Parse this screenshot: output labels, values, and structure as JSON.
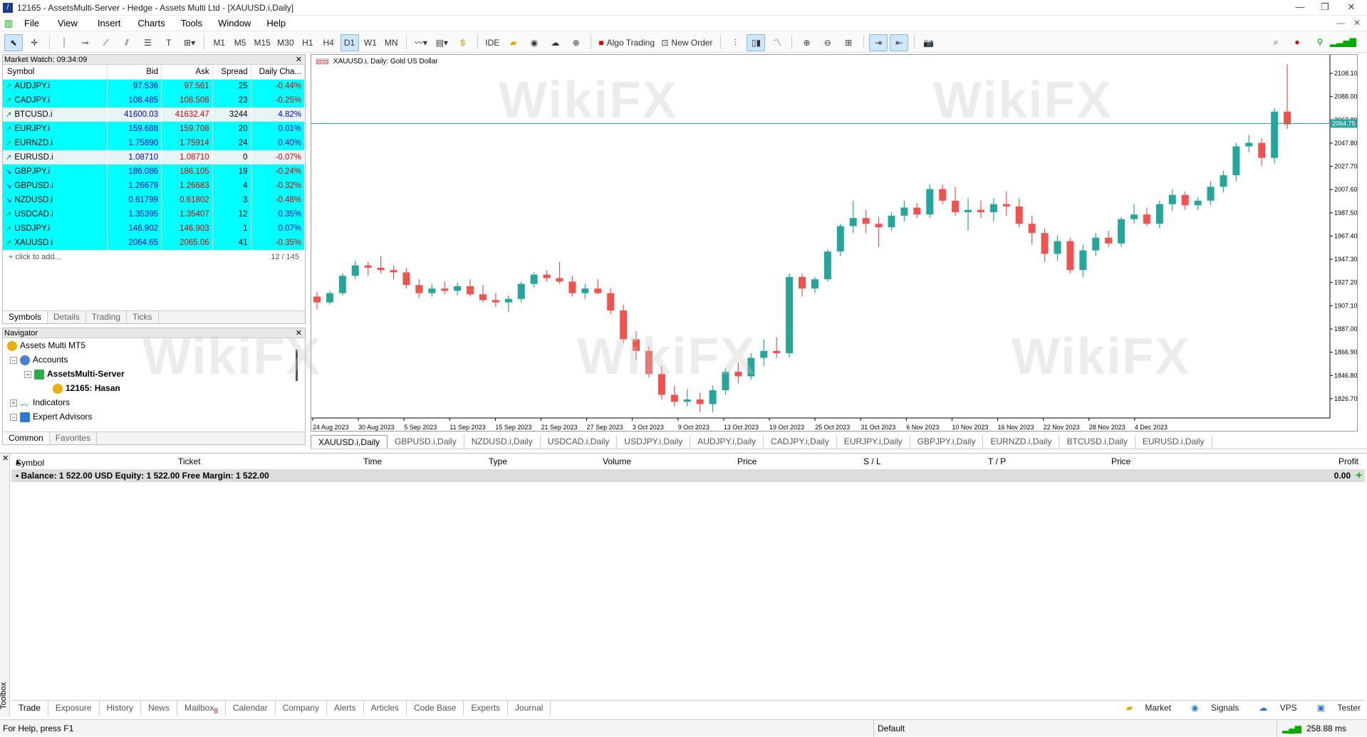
{
  "window": {
    "title": "12165 - AssetsMulti-Server - Hedge - Assets Multi Ltd - [XAUUSD.i,Daily]"
  },
  "menu": [
    "File",
    "View",
    "Insert",
    "Charts",
    "Tools",
    "Window",
    "Help"
  ],
  "timeframes": [
    "M1",
    "M5",
    "M15",
    "M30",
    "H1",
    "H4",
    "D1",
    "W1",
    "MN"
  ],
  "toolbar": {
    "ide": "IDE",
    "algo": "Algo Trading",
    "neworder": "New Order",
    "active_tf": "D1"
  },
  "market_watch": {
    "title": "Market Watch: 09:34:09",
    "columns": [
      "Symbol",
      "Bid",
      "Ask",
      "Spread",
      "Daily Cha..."
    ],
    "rows": [
      {
        "symbol": "AUDJPY.i",
        "bid": "97.536",
        "ask": "97.561",
        "spread": "25",
        "change": "-0.44%",
        "dir": "up"
      },
      {
        "symbol": "CADJPY.i",
        "bid": "108.485",
        "ask": "108.508",
        "spread": "23",
        "change": "-0.25%",
        "dir": "up"
      },
      {
        "symbol": "BTCUSD.i",
        "bid": "41600.03",
        "ask": "41632.47",
        "spread": "3244",
        "change": "4.82%",
        "dir": "alt"
      },
      {
        "symbol": "EURJPY.i",
        "bid": "159.688",
        "ask": "159.708",
        "spread": "20",
        "change": "0.01%",
        "dir": "up"
      },
      {
        "symbol": "EURNZD.i",
        "bid": "1.75890",
        "ask": "1.75914",
        "spread": "24",
        "change": "0.40%",
        "dir": "up"
      },
      {
        "symbol": "EURUSD.i",
        "bid": "1.08710",
        "ask": "1.08710",
        "spread": "0",
        "change": "-0.07%",
        "dir": "alt"
      },
      {
        "symbol": "GBPJPY.i",
        "bid": "186.086",
        "ask": "186.105",
        "spread": "19",
        "change": "-0.24%",
        "dir": "dn"
      },
      {
        "symbol": "GBPUSD.i",
        "bid": "1.26679",
        "ask": "1.26683",
        "spread": "4",
        "change": "-0.32%",
        "dir": "dn"
      },
      {
        "symbol": "NZDUSD.i",
        "bid": "0.61799",
        "ask": "0.61802",
        "spread": "3",
        "change": "-0.48%",
        "dir": "dn"
      },
      {
        "symbol": "USDCAD.i",
        "bid": "1.35395",
        "ask": "1.35407",
        "spread": "12",
        "change": "0.35%",
        "dir": "up"
      },
      {
        "symbol": "USDJPY.i",
        "bid": "146.902",
        "ask": "146.903",
        "spread": "1",
        "change": "0.07%",
        "dir": "up"
      },
      {
        "symbol": "XAUUSD.i",
        "bid": "2064.65",
        "ask": "2065.06",
        "spread": "41",
        "change": "-0.35%",
        "dir": "up"
      }
    ],
    "add_label": "click to add...",
    "count": "12 / 145",
    "tabs": [
      "Symbols",
      "Details",
      "Trading",
      "Ticks"
    ]
  },
  "navigator": {
    "title": "Navigator",
    "root": "Assets Multi MT5",
    "accounts": "Accounts",
    "server": "AssetsMulti-Server",
    "account": "12165: Hasan",
    "indicators": "Indicators",
    "experts": "Expert Advisors",
    "tabs": [
      "Common",
      "Favorites"
    ]
  },
  "chart": {
    "label": "XAUUSD.i, Daily:  Gold US Dollar",
    "current_price": "2064.75"
  },
  "chart_data": {
    "type": "candlestick",
    "ylim": [
      1810,
      2118
    ],
    "yticks": [
      "2108.10",
      "2088.00",
      "2067.80",
      "2047.80",
      "2027.70",
      "2007.60",
      "1987.50",
      "1967.40",
      "1947.30",
      "1927.20",
      "1907.10",
      "1887.00",
      "1866.90",
      "1846.80",
      "1826.70"
    ],
    "xticks": [
      "24 Aug 2023",
      "30 Aug 2023",
      "5 Sep 2023",
      "11 Sep 2023",
      "15 Sep 2023",
      "21 Sep 2023",
      "27 Sep 2023",
      "3 Oct 2023",
      "9 Oct 2023",
      "13 Oct 2023",
      "19 Oct 2023",
      "25 Oct 2023",
      "31 Oct 2023",
      "6 Nov 2023",
      "10 Nov 2023",
      "16 Nov 2023",
      "22 Nov 2023",
      "28 Nov 2023",
      "4 Dec 2023"
    ],
    "hline": 2064.75,
    "candles": [
      [
        1915,
        1919,
        1904,
        1910
      ],
      [
        1910,
        1920,
        1908,
        1918
      ],
      [
        1918,
        1935,
        1916,
        1933
      ],
      [
        1933,
        1946,
        1930,
        1942
      ],
      [
        1942,
        1945,
        1933,
        1940
      ],
      [
        1940,
        1950,
        1935,
        1938
      ],
      [
        1938,
        1942,
        1930,
        1936
      ],
      [
        1936,
        1940,
        1922,
        1925
      ],
      [
        1925,
        1930,
        1914,
        1918
      ],
      [
        1918,
        1926,
        1915,
        1922
      ],
      [
        1922,
        1928,
        1917,
        1920
      ],
      [
        1920,
        1927,
        1916,
        1924
      ],
      [
        1924,
        1930,
        1915,
        1917
      ],
      [
        1917,
        1925,
        1910,
        1912
      ],
      [
        1912,
        1918,
        1906,
        1910
      ],
      [
        1910,
        1916,
        1902,
        1913
      ],
      [
        1913,
        1928,
        1910,
        1926
      ],
      [
        1926,
        1936,
        1923,
        1934
      ],
      [
        1934,
        1938,
        1928,
        1931
      ],
      [
        1931,
        1945,
        1926,
        1928
      ],
      [
        1928,
        1933,
        1915,
        1918
      ],
      [
        1918,
        1926,
        1913,
        1922
      ],
      [
        1922,
        1930,
        1917,
        1918
      ],
      [
        1918,
        1922,
        1900,
        1903
      ],
      [
        1903,
        1908,
        1875,
        1878
      ],
      [
        1878,
        1885,
        1860,
        1868
      ],
      [
        1868,
        1872,
        1845,
        1848
      ],
      [
        1848,
        1855,
        1826,
        1830
      ],
      [
        1830,
        1838,
        1820,
        1824
      ],
      [
        1824,
        1835,
        1820,
        1826
      ],
      [
        1826,
        1832,
        1815,
        1822
      ],
      [
        1822,
        1838,
        1815,
        1834
      ],
      [
        1834,
        1853,
        1830,
        1850
      ],
      [
        1850,
        1858,
        1840,
        1846
      ],
      [
        1846,
        1866,
        1843,
        1862
      ],
      [
        1862,
        1878,
        1855,
        1868
      ],
      [
        1868,
        1880,
        1862,
        1866
      ],
      [
        1866,
        1935,
        1862,
        1932
      ],
      [
        1932,
        1935,
        1915,
        1922
      ],
      [
        1922,
        1932,
        1918,
        1930
      ],
      [
        1930,
        1956,
        1928,
        1954
      ],
      [
        1954,
        1978,
        1950,
        1976
      ],
      [
        1976,
        1998,
        1970,
        1983
      ],
      [
        1983,
        1990,
        1970,
        1978
      ],
      [
        1978,
        1984,
        1958,
        1975
      ],
      [
        1975,
        1988,
        1972,
        1985
      ],
      [
        1985,
        1998,
        1980,
        1992
      ],
      [
        1992,
        1996,
        1983,
        1986
      ],
      [
        1986,
        2012,
        1983,
        2008
      ],
      [
        2008,
        2012,
        1995,
        1998
      ],
      [
        1998,
        2010,
        1985,
        1988
      ],
      [
        1988,
        2000,
        1972,
        1990
      ],
      [
        1990,
        1998,
        1983,
        1988
      ],
      [
        1988,
        2000,
        1980,
        1995
      ],
      [
        1995,
        2006,
        1985,
        1993
      ],
      [
        1993,
        2000,
        1975,
        1978
      ],
      [
        1978,
        1985,
        1960,
        1970
      ],
      [
        1970,
        1974,
        1945,
        1952
      ],
      [
        1952,
        1968,
        1946,
        1963
      ],
      [
        1963,
        1966,
        1935,
        1938
      ],
      [
        1938,
        1960,
        1932,
        1955
      ],
      [
        1955,
        1970,
        1950,
        1966
      ],
      [
        1966,
        1972,
        1958,
        1961
      ],
      [
        1961,
        1984,
        1958,
        1982
      ],
      [
        1982,
        1995,
        1978,
        1986
      ],
      [
        1986,
        1992,
        1976,
        1978
      ],
      [
        1978,
        1998,
        1974,
        1995
      ],
      [
        1995,
        2008,
        1989,
        2003
      ],
      [
        2003,
        2006,
        1990,
        1994
      ],
      [
        1994,
        2001,
        1990,
        1998
      ],
      [
        1998,
        2015,
        1994,
        2010
      ],
      [
        2010,
        2024,
        2005,
        2020
      ],
      [
        2020,
        2048,
        2015,
        2045
      ],
      [
        2045,
        2055,
        2040,
        2048
      ],
      [
        2048,
        2052,
        2028,
        2035
      ],
      [
        2035,
        2078,
        2030,
        2075
      ],
      [
        2075,
        2116,
        2060,
        2064
      ]
    ]
  },
  "chart_tabs": [
    "XAUUSD.i,Daily",
    "GBPUSD.i,Daily",
    "NZDUSD.i,Daily",
    "USDCAD.i,Daily",
    "USDJPY.i,Daily",
    "AUDJPY.i,Daily",
    "CADJPY.i,Daily",
    "EURJPY.i,Daily",
    "GBPJPY.i,Daily",
    "EURNZD.i,Daily",
    "BTCUSD.i,Daily",
    "EURUSD.i,Daily"
  ],
  "trade": {
    "columns": [
      "Symbol",
      "Ticket",
      "Time",
      "Type",
      "Volume",
      "Price",
      "S / L",
      "T / P",
      "Price",
      "Profit"
    ],
    "balance": "Balance: 1 522.00 USD  Equity: 1 522.00  Free Margin: 1 522.00",
    "profit": "0.00"
  },
  "bottom_tabs": [
    "Trade",
    "Exposure",
    "History",
    "News",
    "Mailbox",
    "Calendar",
    "Company",
    "Alerts",
    "Articles",
    "Code Base",
    "Experts",
    "Journal"
  ],
  "mailbox_badge": "8",
  "bottom_right": [
    "Market",
    "Signals",
    "VPS",
    "Tester"
  ],
  "toolbox_label": "Toolbox",
  "status": {
    "help": "For Help, press F1",
    "profile": "Default",
    "ping": "258.88 ms"
  },
  "watermark": "WikiFX",
  "colors": {
    "bull": "#26a69a",
    "bear": "#ef5350",
    "line": "#26a69a",
    "mw_row": "#00ffff"
  }
}
